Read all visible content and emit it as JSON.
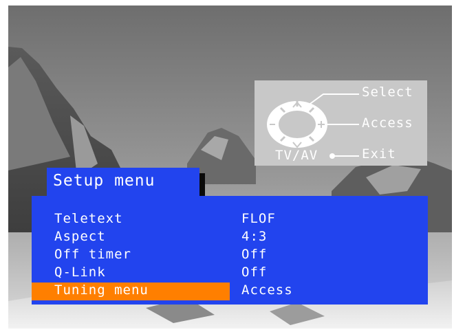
{
  "remote_legend": {
    "select_label": "Select",
    "access_label": "Access",
    "exit_label": "Exit",
    "tvav_label": "TV/AV",
    "up_symbol": "^",
    "down_symbol": "v",
    "left_symbol": "–",
    "plus_symbol": "+"
  },
  "menu": {
    "title": "Setup menu",
    "items": [
      {
        "label": "Teletext",
        "value": "FLOF",
        "selected": false
      },
      {
        "label": "Aspect",
        "value": "4:3",
        "selected": false
      },
      {
        "label": "Off timer",
        "value": "Off",
        "selected": false
      },
      {
        "label": "Q-Link",
        "value": "Off",
        "selected": false
      },
      {
        "label": "Tuning menu",
        "value": "Access",
        "selected": true
      }
    ]
  },
  "colors": {
    "panel_blue": "#2244ee",
    "highlight_orange": "#ff7f00",
    "legend_gray": "#c8c8c8",
    "text_white": "#ffffff"
  }
}
